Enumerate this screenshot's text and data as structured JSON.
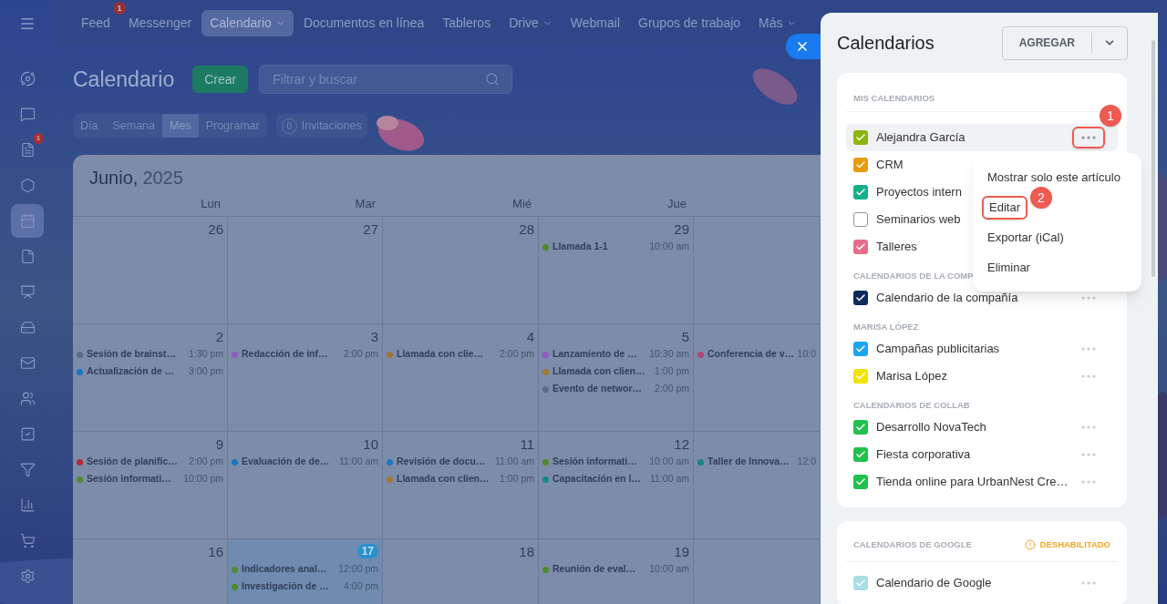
{
  "sidebar": {
    "items": [
      {
        "selected": false
      },
      {
        "selected": false
      },
      {
        "selected": false,
        "badge": "1"
      },
      {
        "selected": false
      },
      {
        "selected": true
      },
      {
        "selected": false
      },
      {
        "selected": false
      },
      {
        "selected": false
      },
      {
        "selected": false
      },
      {
        "selected": false
      },
      {
        "selected": false
      },
      {
        "selected": false
      },
      {
        "selected": false
      },
      {
        "selected": false
      },
      {
        "selected": false
      }
    ]
  },
  "topnav": {
    "items": [
      {
        "label": "Feed",
        "selected": false,
        "badge": "1",
        "has_menu": false
      },
      {
        "label": "Messenger",
        "selected": false,
        "has_menu": false
      },
      {
        "label": "Calendario",
        "selected": true,
        "has_menu": true
      },
      {
        "label": "Documentos en línea",
        "selected": false,
        "has_menu": false
      },
      {
        "label": "Tableros",
        "selected": false,
        "has_menu": false
      },
      {
        "label": "Drive",
        "selected": false,
        "has_menu": true
      },
      {
        "label": "Webmail",
        "selected": false,
        "has_menu": false
      },
      {
        "label": "Grupos de trabajo",
        "selected": false,
        "has_menu": false
      },
      {
        "label": "Más",
        "selected": false,
        "has_menu": true
      }
    ]
  },
  "toolbar": {
    "title": "Calendario",
    "create_button": "Crear",
    "search": {
      "placeholder": "Filtrar y buscar"
    },
    "views": [
      {
        "label": "Día",
        "selected": false
      },
      {
        "label": "Semana",
        "selected": false
      },
      {
        "label": "Mes",
        "selected": true
      },
      {
        "label": "Programar",
        "selected": false
      }
    ],
    "invitations": {
      "count": "0",
      "label": "Invitaciones"
    }
  },
  "calendar": {
    "month": "Junio,",
    "year": "2025",
    "weekdays": [
      "Lun",
      "Mar",
      "Mié",
      "Jue"
    ],
    "weeks": [
      {
        "days": [
          {
            "number": "26",
            "today": false
          },
          {
            "number": "27",
            "today": false
          },
          {
            "number": "28",
            "today": false
          },
          {
            "number": "29",
            "today": false,
            "events": [
              {
                "title": "Llamada 1-1",
                "time": "10:00 am",
                "color": "#4e8a2e"
              }
            ]
          }
        ]
      },
      {
        "days": [
          {
            "number": "2",
            "today": false,
            "events": [
              {
                "title": "Sesión de brainst…",
                "time": "1:30 pm",
                "color": "#5b6b85"
              },
              {
                "title": "Actualización de …",
                "time": "3:00 pm",
                "color": "#1a76c2"
              }
            ]
          },
          {
            "number": "3",
            "today": false,
            "events": [
              {
                "title": "Redacción de inf…",
                "time": "2:00 pm",
                "color": "#8e5cc0"
              }
            ]
          },
          {
            "number": "4",
            "today": false,
            "events": [
              {
                "title": "Llamada con clie…",
                "time": "2:00 pm",
                "color": "#a0763a"
              }
            ]
          },
          {
            "number": "5",
            "today": false,
            "events": [
              {
                "title": "Lanzamiento de …",
                "time": "10:30 am",
                "color": "#8e5cc0"
              },
              {
                "title": "Llamada con clien…",
                "time": "1:00 pm",
                "color": "#a0763a"
              },
              {
                "title": "Evento de networ…",
                "time": "2:00 pm",
                "color": "#5b6b85"
              }
            ]
          },
          {
            "events": [
              {
                "title": "Conferencia de v…",
                "time": "10:0",
                "color": "#b5467a"
              }
            ]
          }
        ]
      },
      {
        "days": [
          {
            "number": "9",
            "today": false,
            "events": [
              {
                "title": "Sesión de planific…",
                "time": "2:00 pm",
                "color": "#b02a3a"
              },
              {
                "title": "Sesión informati…",
                "time": "10:00 pm",
                "color": "#4e8a2e"
              }
            ]
          },
          {
            "number": "10",
            "today": false,
            "events": [
              {
                "title": "Evaluación de de…",
                "time": "11:00 am",
                "color": "#1a76c2"
              }
            ]
          },
          {
            "number": "11",
            "today": false,
            "events": [
              {
                "title": "Revisión de docu…",
                "time": "11:00 am",
                "color": "#1a76c2"
              },
              {
                "title": "Llamada con clien…",
                "time": "1:00 pm",
                "color": "#a0763a"
              }
            ]
          },
          {
            "number": "12",
            "today": false,
            "events": [
              {
                "title": "Sesión informati…",
                "time": "10:00 am",
                "color": "#4e8a2e"
              },
              {
                "title": "Capacitación en l…",
                "time": "11:00 am",
                "color": "#138a8a"
              }
            ]
          },
          {
            "events": [
              {
                "title": "Taller de Innova…",
                "time": "12:0",
                "color": "#138a8a"
              }
            ]
          }
        ]
      },
      {
        "days": [
          {
            "number": "16",
            "today": false
          },
          {
            "number": "17",
            "today": true,
            "events": [
              {
                "title": "Indicadores anal…",
                "time": "12:00 pm",
                "color": "#4e8a2e"
              },
              {
                "title": "Investigación de …",
                "time": "4:00 pm",
                "color": "#4e8a2e"
              }
            ]
          },
          {
            "number": "18",
            "today": false
          },
          {
            "number": "19",
            "today": false,
            "events": [
              {
                "title": "Reunión de eval…",
                "time": "10:00 am",
                "color": "#4e8a2e"
              }
            ]
          }
        ]
      }
    ]
  },
  "panel": {
    "title": "Calendarios",
    "add_button": "AGREGAR",
    "groups": [
      {
        "title": "MIS CALENDARIOS",
        "items": [
          {
            "name": "Alejandra García",
            "color": "#8db50f",
            "checked": true,
            "selected": true,
            "more_button": true,
            "callout": "1"
          },
          {
            "name": "CRM",
            "color": "#e89b0c",
            "checked": true,
            "selected": false
          },
          {
            "name": "Proyectos intern",
            "color": "#14b08a",
            "checked": true,
            "selected": false
          },
          {
            "name": "Seminarios web",
            "color": "#8a94a6",
            "checked": false,
            "selected": false
          },
          {
            "name": "Talleres",
            "color": "#e86b8a",
            "checked": true,
            "selected": false
          }
        ]
      },
      {
        "title": "CALENDARIOS DE LA COMP",
        "items": [
          {
            "name": "Calendario de la compañía",
            "color": "#0c2a5e",
            "checked": true,
            "selected": false,
            "more_button": true
          }
        ]
      },
      {
        "title": "MARISA LÓPEZ",
        "items": [
          {
            "name": "Campañas publicitarias",
            "color": "#1ea4f0",
            "checked": true,
            "selected": false,
            "more_button": true
          },
          {
            "name": "Marisa López",
            "color": "#f2e40a",
            "checked": true,
            "selected": false,
            "more_button": true
          }
        ]
      },
      {
        "title": "CALENDARIOS DE COLLAB",
        "items": [
          {
            "name": "Desarrollo NovaTech",
            "color": "#22c04e",
            "checked": true,
            "selected": false,
            "more_button": true
          },
          {
            "name": "Fiesta corporativa",
            "color": "#22c04e",
            "checked": true,
            "selected": false,
            "more_button": true
          },
          {
            "name": "Tienda online para UrbanNest Cre…",
            "color": "#22c04e",
            "checked": true,
            "selected": false,
            "more_button": true
          }
        ]
      }
    ],
    "google": {
      "title": "CALENDARIOS DE GOOGLE",
      "status": "DESHABILITADO",
      "items": [
        {
          "name": "Calendario de Google",
          "color": "#a8dde6",
          "checked": true,
          "selected": false,
          "more_button": true
        }
      ]
    },
    "menu": {
      "items": [
        {
          "label": "Mostrar solo este artículo"
        },
        {
          "label": "Editar",
          "callout": "2"
        },
        {
          "label": "Exportar (iCal)"
        },
        {
          "label": "Eliminar"
        }
      ]
    }
  }
}
